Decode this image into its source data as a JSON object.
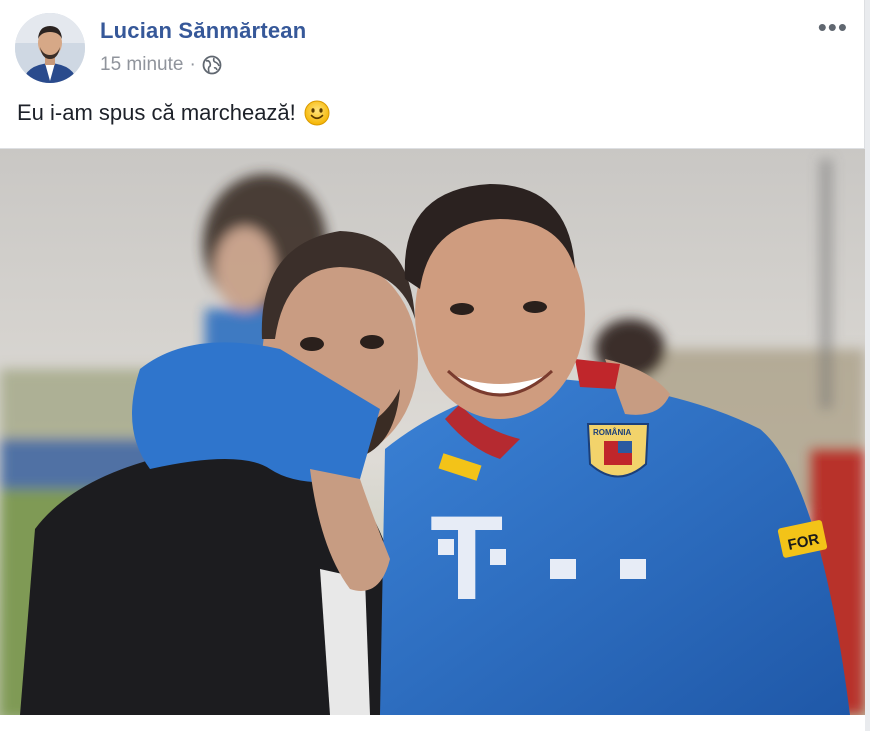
{
  "post": {
    "author": "Lucian Sănmărtean",
    "timestamp": "15 minute",
    "separator": "·",
    "privacy_icon": "globe-icon",
    "more_label": "•••",
    "text": "Eu i-am spus că marchează!",
    "emoji": "smiley-emoji"
  },
  "photo": {
    "jersey_logo_text": "T",
    "badge_text": "ROMÂNIA",
    "sponsor_text": "FOR"
  },
  "colors": {
    "author_link": "#365899",
    "meta": "#90949c",
    "jersey": "#2f6fc0"
  }
}
